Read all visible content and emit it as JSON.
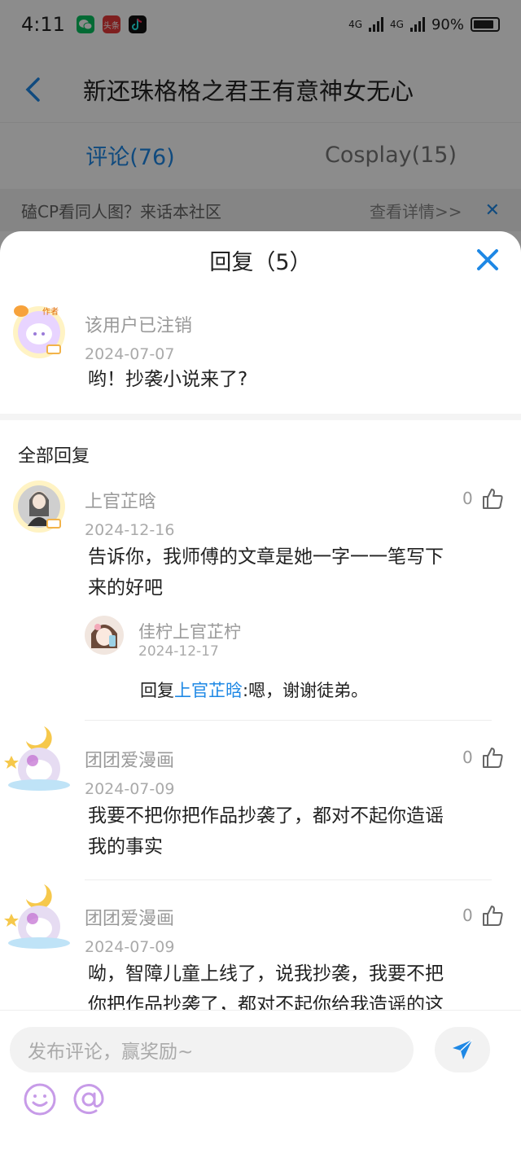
{
  "status": {
    "time": "4:11",
    "apps": [
      {
        "icon": "wechat-icon",
        "label": "",
        "color": "#07c160"
      },
      {
        "icon": "toutiao-icon",
        "label": "头条",
        "color": "#e63939"
      },
      {
        "icon": "tiktok-icon",
        "label": "",
        "color": "#111111"
      }
    ],
    "net1": "4G",
    "net2": "4G",
    "battery": "90%"
  },
  "nav": {
    "title": "新还珠格格之君王有意神女无心"
  },
  "tabs": [
    {
      "label": "评论(76)",
      "active": true
    },
    {
      "label": "Cosplay(15)",
      "active": false
    }
  ],
  "banner": {
    "text": "磕CP看同人图？来话本社区",
    "link": "查看详情>>"
  },
  "sheet": {
    "title": "回复（5）",
    "root": {
      "user": "该用户已注销",
      "date": "2024-07-07",
      "text": "哟！抄袭小说来了?",
      "badge": "作者"
    },
    "all_label": "全部回复",
    "replies": [
      {
        "user": "上官芷晗",
        "date": "2024-12-16",
        "likes": "0",
        "badge": "作者",
        "text_lines": [
          "告诉你，我师傅的文章是她一字一一笔写下",
          "来的好吧"
        ],
        "sub": {
          "user": "佳柠上官芷柠",
          "date": "2024-12-17",
          "prefix": "回复",
          "mention": "上官芷晗",
          "text": ":嗯，谢谢徒弟。"
        }
      },
      {
        "user": "团团爱漫画",
        "date": "2024-07-09",
        "likes": "0",
        "text_lines": [
          "我要不把你把作品抄袭了，都对不起你造谣",
          "我的事实"
        ]
      },
      {
        "user": "团团爱漫画",
        "date": "2024-07-09",
        "likes": "0",
        "text_lines": [
          "呦，智障儿童上线了，说我抄袭，我要不把",
          "你把作品抄袭了，都对不起你给我造谣的这"
        ]
      }
    ]
  },
  "composer": {
    "placeholder": "发布评论，赢奖励~",
    "emoji_icon": "smiley-icon",
    "mention_icon": "at-icon",
    "send_icon": "send-icon"
  },
  "colors": {
    "accent": "#1e88e5",
    "dim": "rgba(0,0,0,0.45)"
  }
}
